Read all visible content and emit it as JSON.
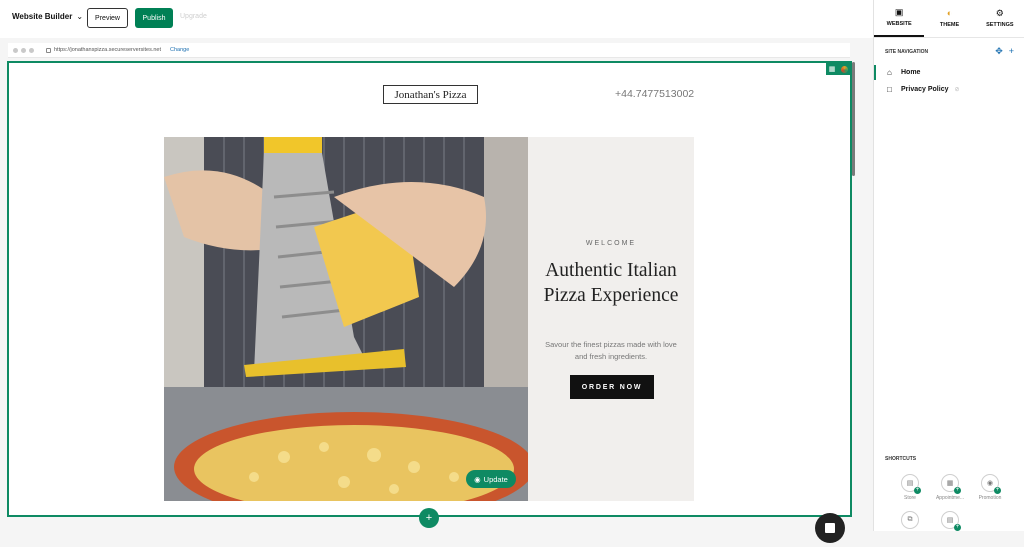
{
  "toolbar": {
    "site_menu_label": "Website Builder",
    "preview_label": "Preview",
    "publish_label": "Publish",
    "upgrade_label": "Upgrade"
  },
  "browser": {
    "url": "https://jonathanspizza.secureserversites.net",
    "change_label": "Change"
  },
  "site": {
    "logo_text": "Jonathan's Pizza",
    "phone": "+44.7477513002",
    "hero": {
      "eyebrow": "WELCOME",
      "title": "Authentic Italian Pizza Experience",
      "subtitle": "Savour the finest pizzas made with love and fresh ingredients.",
      "cta_label": "ORDER NOW",
      "update_label": "Update"
    }
  },
  "panel": {
    "tabs": [
      {
        "label": "WEBSITE",
        "icon": "layout-icon",
        "active": true
      },
      {
        "label": "THEME",
        "icon": "palette-icon",
        "active": false
      },
      {
        "label": "SETTINGS",
        "icon": "gear-icon",
        "active": false
      }
    ],
    "nav_heading": "SITE NAVIGATION",
    "pages": [
      {
        "label": "Home",
        "icon": "home-icon",
        "active": true
      },
      {
        "label": "Privacy Policy",
        "icon": "page-icon",
        "active": false
      }
    ],
    "shortcuts_heading": "SHORTCUTS",
    "shortcuts": [
      {
        "label": "Store",
        "icon": "store-icon"
      },
      {
        "label": "Appointme...",
        "icon": "calendar-icon"
      },
      {
        "label": "Promotion",
        "icon": "tag-icon"
      },
      {
        "label": "",
        "icon": "copy-icon"
      },
      {
        "label": "",
        "icon": "form-icon"
      }
    ]
  },
  "colors": {
    "accent_green": "#0e8a63",
    "publish_green": "#008055",
    "link_blue": "#1b6fb0"
  }
}
